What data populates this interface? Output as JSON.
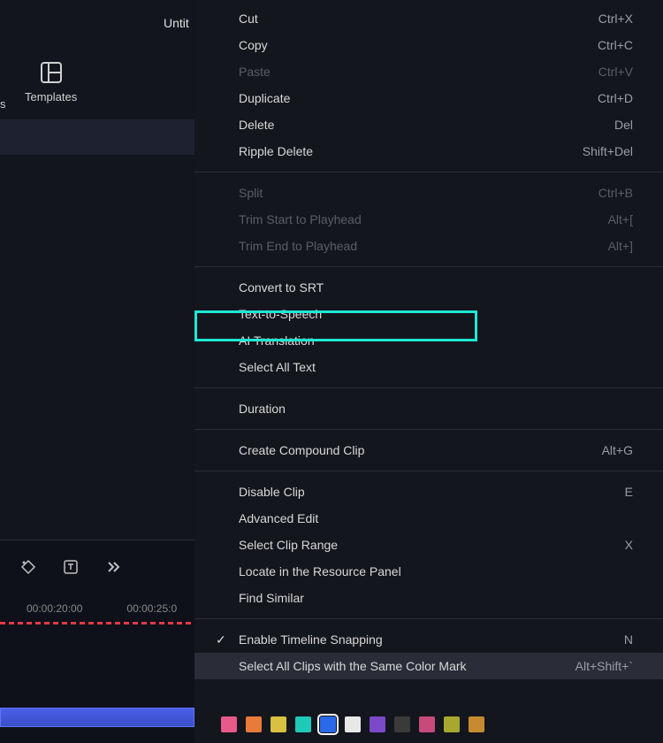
{
  "top_title": "Untit",
  "sidebar": {
    "tail_letter": "s",
    "templates_label": "Templates"
  },
  "timeline": {
    "time_labels": [
      "00:00:20:00",
      "00:00:25:0"
    ]
  },
  "context_menu": {
    "groups": [
      [
        {
          "label": "Cut",
          "shortcut": "Ctrl+X",
          "disabled": false
        },
        {
          "label": "Copy",
          "shortcut": "Ctrl+C",
          "disabled": false
        },
        {
          "label": "Paste",
          "shortcut": "Ctrl+V",
          "disabled": true
        },
        {
          "label": "Duplicate",
          "shortcut": "Ctrl+D",
          "disabled": false
        },
        {
          "label": "Delete",
          "shortcut": "Del",
          "disabled": false
        },
        {
          "label": "Ripple Delete",
          "shortcut": "Shift+Del",
          "disabled": false
        }
      ],
      [
        {
          "label": "Split",
          "shortcut": "Ctrl+B",
          "disabled": true
        },
        {
          "label": "Trim Start to Playhead",
          "shortcut": "Alt+[",
          "disabled": true
        },
        {
          "label": "Trim End to Playhead",
          "shortcut": "Alt+]",
          "disabled": true
        }
      ],
      [
        {
          "label": "Convert to SRT",
          "shortcut": "",
          "disabled": false
        },
        {
          "label": "Text-to-Speech",
          "shortcut": "",
          "disabled": false,
          "highlighted": true
        },
        {
          "label": "AI Translation",
          "shortcut": "",
          "disabled": false
        },
        {
          "label": "Select All Text",
          "shortcut": "",
          "disabled": false
        }
      ],
      [
        {
          "label": "Duration",
          "shortcut": "",
          "disabled": false
        }
      ],
      [
        {
          "label": "Create Compound Clip",
          "shortcut": "Alt+G",
          "disabled": false
        }
      ],
      [
        {
          "label": "Disable Clip",
          "shortcut": "E",
          "disabled": false
        },
        {
          "label": "Advanced Edit",
          "shortcut": "",
          "disabled": false
        },
        {
          "label": "Select Clip Range",
          "shortcut": "X",
          "disabled": false
        },
        {
          "label": "Locate in the Resource Panel",
          "shortcut": "",
          "disabled": false
        },
        {
          "label": "Find Similar",
          "shortcut": "",
          "disabled": false
        }
      ],
      [
        {
          "label": "Enable Timeline Snapping",
          "shortcut": "N",
          "disabled": false,
          "checked": true
        },
        {
          "label": "Select All Clips with the Same Color Mark",
          "shortcut": "Alt+Shift+`",
          "disabled": false,
          "hovered": true
        }
      ]
    ]
  },
  "color_swatches": [
    {
      "color": "#e85a8a",
      "selected": false
    },
    {
      "color": "#e87a3a",
      "selected": false
    },
    {
      "color": "#d8c040",
      "selected": false
    },
    {
      "color": "#1fc9b8",
      "selected": false
    },
    {
      "color": "#2a6ae8",
      "selected": true
    },
    {
      "color": "#e8e8e8",
      "selected": false
    },
    {
      "color": "#7a4ac8",
      "selected": false
    },
    {
      "color": "#3a3a3a",
      "selected": false
    },
    {
      "color": "#c84a7a",
      "selected": false
    },
    {
      "color": "#a8a830",
      "selected": false
    },
    {
      "color": "#c88a30",
      "selected": false
    }
  ]
}
